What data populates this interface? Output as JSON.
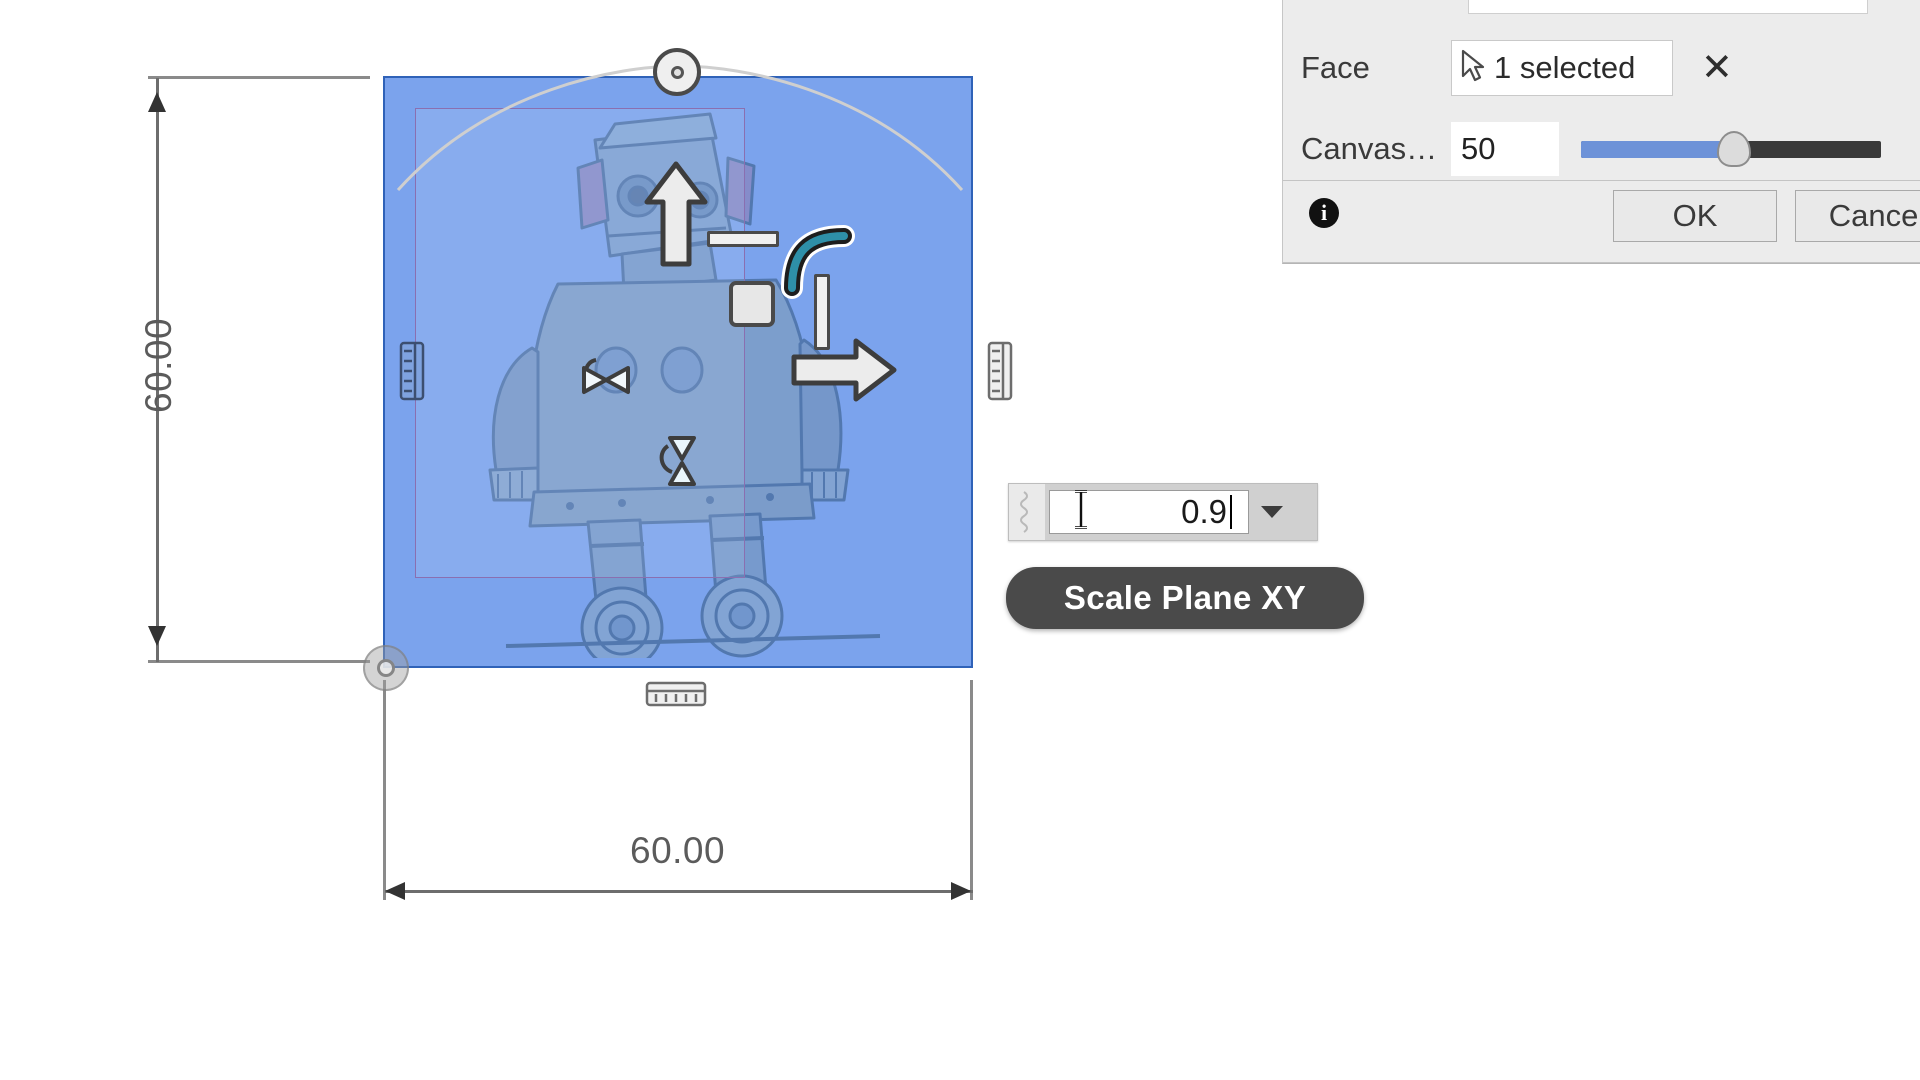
{
  "app": {
    "scene_label": "cad-sketch-canvas"
  },
  "canvas": {
    "dimension_vertical": "60.00",
    "dimension_horizontal": "60.00",
    "selection_color": "#5a8ce8",
    "selection_border_color": "#2f62b8",
    "inner_rect_color": "#8a6fb0",
    "gizmo": {
      "rotate_handle": "rotate-knob",
      "y_axis_arrow": "up-arrow",
      "x_axis_arrow": "right-arrow",
      "scale_square": "square-scale-handle",
      "arc_handle": "teal-arc-handle",
      "bowtie_horizontal": "bowtie-handle-x",
      "bowtie_vertical": "bowtie-handle-y",
      "edge_grip_left": "left-edge-grip",
      "edge_grip_right": "right-edge-grip",
      "edge_grip_bottom": "bottom-edge-grip",
      "origin": "origin-pivot"
    }
  },
  "value_input": {
    "value": "0.9",
    "dropdown_glyph": "chevron-down"
  },
  "tooltip": {
    "label": "Scale Plane XY"
  },
  "dialog": {
    "rows": [
      {
        "label": "Face",
        "value": "1 selected",
        "clear_glyph": "✕"
      },
      {
        "label": "Canvas…",
        "value": "50"
      }
    ],
    "slider": {
      "value": 50,
      "fill_color": "#6d92d8",
      "track_color": "#3a3a3a"
    },
    "info_glyph": "i",
    "buttons": {
      "ok": "OK",
      "cancel": "Cancel"
    }
  }
}
